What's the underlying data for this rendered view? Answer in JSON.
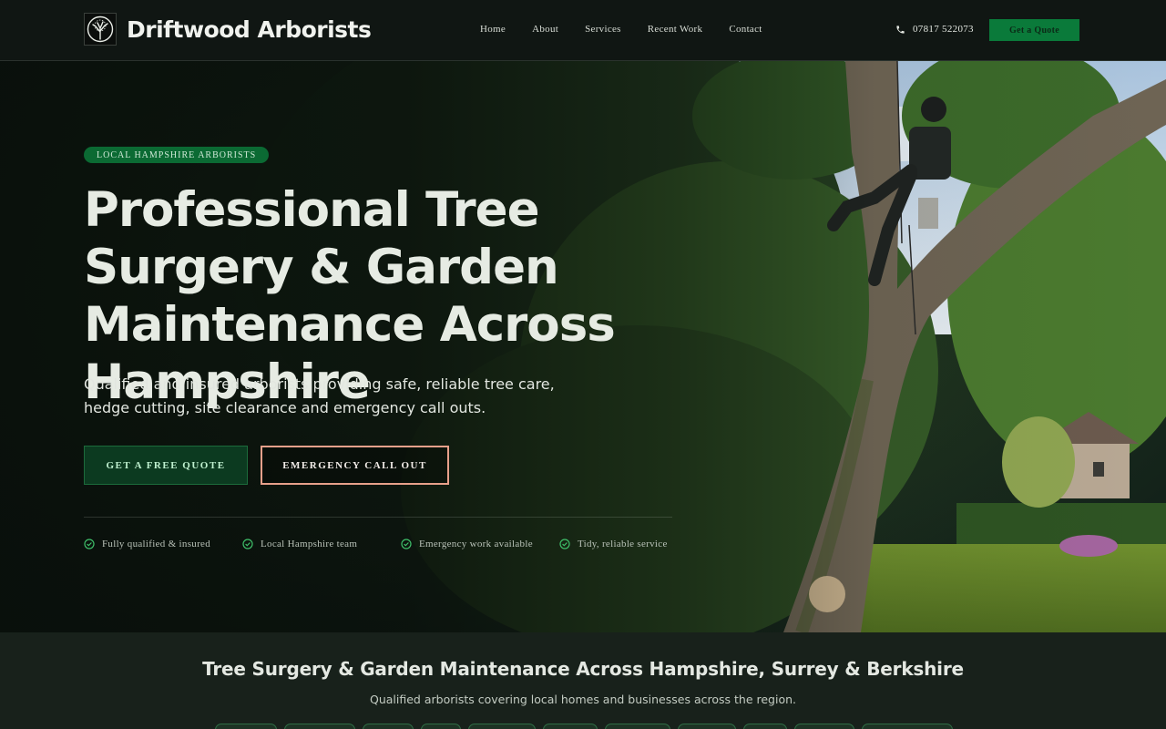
{
  "header": {
    "brand": "Driftwood Arborists",
    "nav": [
      "Home",
      "About",
      "Services",
      "Recent Work",
      "Contact"
    ],
    "phone": "07817 522073",
    "quote_label": "Get a Quote"
  },
  "hero": {
    "badge": "LOCAL HAMPSHIRE ARBORISTS",
    "headline": "Professional Tree Surgery & Garden Maintenance Across Hampshire",
    "subhead": "Qualified and insured arborists providing safe, reliable tree care, hedge cutting, site clearance and emergency call outs.",
    "cta_primary": "GET A FREE QUOTE",
    "cta_secondary": "EMERGENCY CALL OUT",
    "trust": [
      "Fully qualified & insured",
      "Local Hampshire team",
      "Emergency work available",
      "Tidy, reliable service"
    ]
  },
  "intro": {
    "title": "Tree Surgery & Garden Maintenance Across Hampshire, Surrey & Berkshire",
    "subtitle": "Qualified arborists covering local homes and businesses across the region."
  },
  "colors": {
    "accent_green": "#0a7a3a",
    "cta_outline": "#e7a08a",
    "background": "#101613"
  },
  "icons": [
    "tree-logo-icon",
    "phone-icon",
    "check-circle-icon"
  ]
}
